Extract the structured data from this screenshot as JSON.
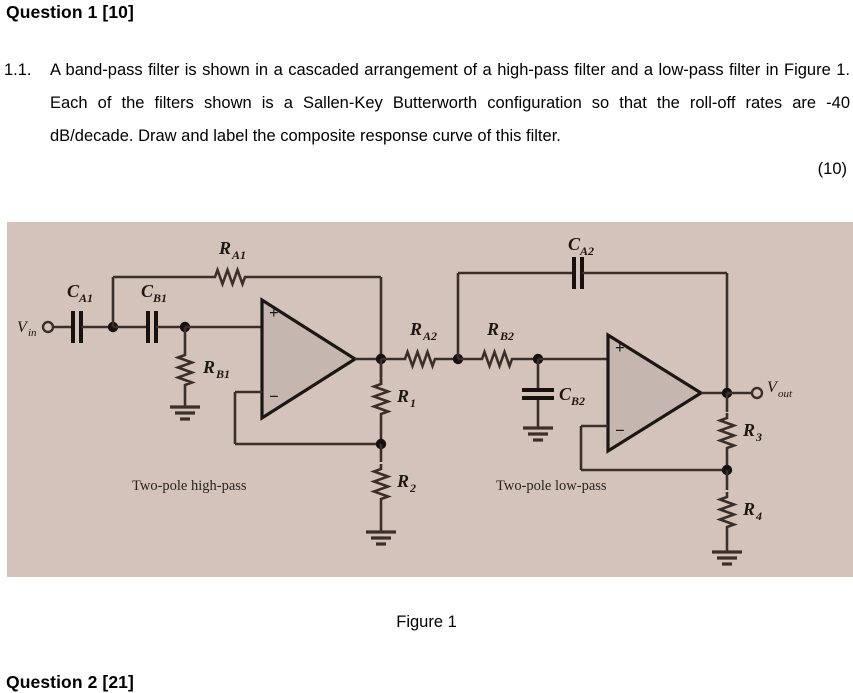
{
  "document": {
    "question1_heading": "Question 1 [10]",
    "question2_heading": "Question 2 [21]",
    "item_number": "1.1.",
    "item_text": "A band-pass filter is shown in a cascaded arrangement of a high-pass filter and a low-pass filter in Figure 1. Each of the filters shown is a Sallen-Key Butterworth configuration so that the roll-off rates are -40 dB/decade. Draw and label the composite response curve of this filter.",
    "item_marks": "(10)",
    "figure_caption": "Figure 1"
  },
  "figure": {
    "background_color": "#d4c3ba",
    "wire_color": "#3a2f2b",
    "opamp_fill": "#c6b8b0",
    "stage_labels": {
      "left": "Two-pole high-pass",
      "right": "Two-pole low-pass"
    },
    "terminals": {
      "input_main": "V",
      "input_sub": "in",
      "output_main": "V",
      "output_sub": "out"
    },
    "opamp_signs": {
      "plus": "+",
      "minus": "−"
    },
    "components": [
      {
        "id": "CA1",
        "type": "capacitor",
        "main": "C",
        "sub": "A1"
      },
      {
        "id": "CB1",
        "type": "capacitor",
        "main": "C",
        "sub": "B1"
      },
      {
        "id": "RA1",
        "type": "resistor",
        "main": "R",
        "sub": "A1"
      },
      {
        "id": "RB1",
        "type": "resistor",
        "main": "R",
        "sub": "B1"
      },
      {
        "id": "R1",
        "type": "resistor",
        "main": "R",
        "sub": "1"
      },
      {
        "id": "R2",
        "type": "resistor",
        "main": "R",
        "sub": "2"
      },
      {
        "id": "RA2",
        "type": "resistor",
        "main": "R",
        "sub": "A2"
      },
      {
        "id": "RB2",
        "type": "resistor",
        "main": "R",
        "sub": "B2"
      },
      {
        "id": "CA2",
        "type": "capacitor",
        "main": "C",
        "sub": "A2"
      },
      {
        "id": "CB2",
        "type": "capacitor",
        "main": "C",
        "sub": "B2"
      },
      {
        "id": "R3",
        "type": "resistor",
        "main": "R",
        "sub": "3"
      },
      {
        "id": "R4",
        "type": "resistor",
        "main": "R",
        "sub": "4"
      }
    ]
  }
}
